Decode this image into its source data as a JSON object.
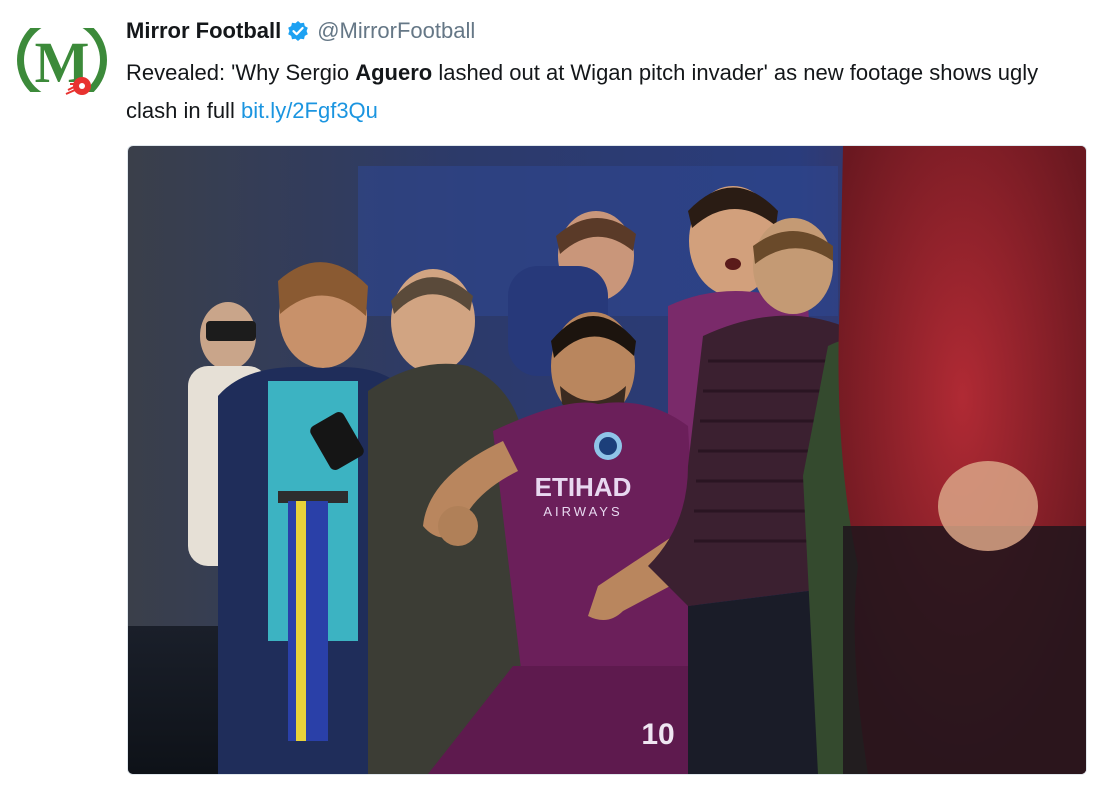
{
  "account": {
    "display_name": "Mirror Football",
    "handle": "@MirrorFootball",
    "verified": true,
    "avatar_icon": "mirror-football-logo",
    "avatar_letter": "M"
  },
  "tweet": {
    "text_before": "Revealed: 'Why Sergio ",
    "text_bold": "Aguero",
    "text_after": " lashed out at Wigan pitch invader' as new footage shows ugly clash in full ",
    "link": "bit.ly/2Fgf3Qu"
  },
  "media": {
    "kit_sponsor_line1": "ETIHAD",
    "kit_sponsor_line2": "AIRWAYS",
    "shirt_number": "10"
  },
  "colors": {
    "link": "#1b95e0",
    "handle": "#657786",
    "verified": "#1da1f2",
    "logo_green": "#3c8a3a",
    "kit_purple": "#6b1f5a"
  }
}
